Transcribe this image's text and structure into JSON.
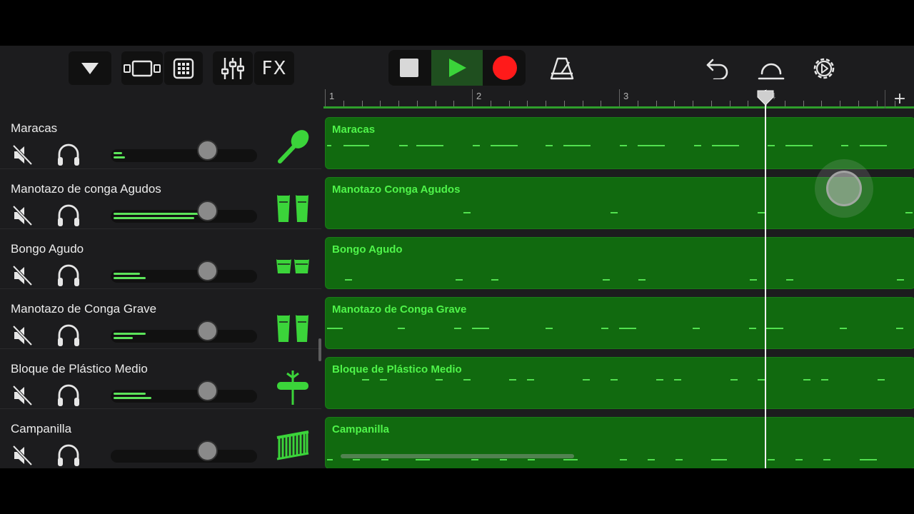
{
  "toolbar": {
    "fx_label": "FX"
  },
  "ruler": {
    "bars": [
      "1",
      "2",
      "3",
      "4"
    ]
  },
  "playhead_bar": 3.95,
  "colors": {
    "region_fill": "#116a0f",
    "region_text": "#4ff44a",
    "play_green": "#3bd43a",
    "record_red": "#ff1a1a",
    "meter": "#5ce45a"
  },
  "tracks": [
    {
      "name": "Maracas",
      "region": "Maracas",
      "icon": "maracas-icon",
      "volume": 0.66,
      "meter": [
        0.06,
        0.08
      ]
    },
    {
      "name": "Manotazo de conga Agudos",
      "region": "Manotazo Conga Agudos",
      "icon": "conga-icon",
      "volume": 0.66,
      "meter": [
        0.62,
        0.55
      ]
    },
    {
      "name": "Bongo Agudo",
      "region": "Bongo Agudo",
      "icon": "bongo-icon",
      "volume": 0.66,
      "meter": [
        0.18,
        0.22
      ]
    },
    {
      "name": "Manotazo de Conga Grave",
      "region": "Manotazo de Conga Grave",
      "icon": "conga-icon",
      "volume": 0.66,
      "meter": [
        0.22,
        0.13
      ]
    },
    {
      "name": "Bloque de Plástico Medio",
      "region": "Bloque de Plástico Medio",
      "icon": "block-icon",
      "volume": 0.66,
      "meter": [
        0.22,
        0.26
      ]
    },
    {
      "name": "Campanilla",
      "region": "Campanilla",
      "icon": "chimes-icon",
      "volume": 0.66,
      "meter": [
        0,
        0
      ]
    }
  ]
}
